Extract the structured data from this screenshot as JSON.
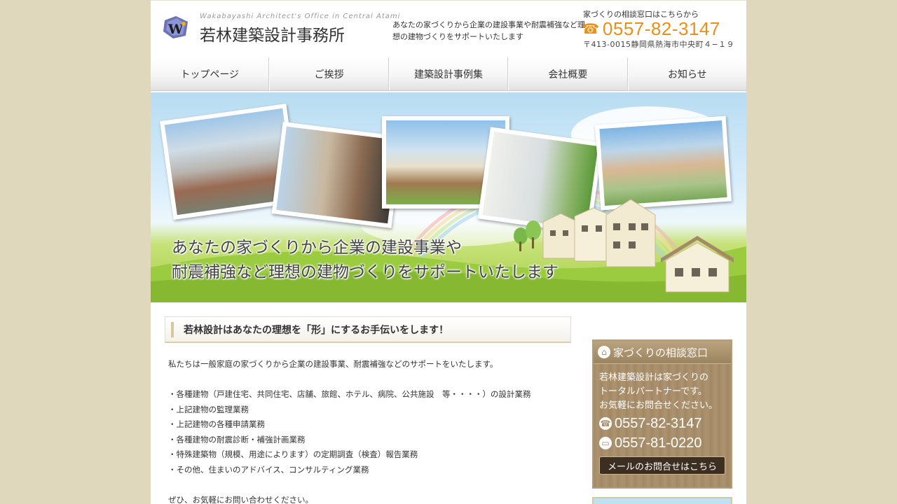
{
  "header": {
    "logo_mark": "W",
    "logo_en": "Wakabayashi Architect's Office in Central Atami",
    "logo_jp": "若林建築設計事務所",
    "tagline": "あなたの家づくりから企業の建設事業や耐震補強など理想の建物づくりをサポートいたします",
    "contact_label": "家づくりの相談窓口はこちらから",
    "phone": "0557-82-3147",
    "address": "〒413-0015静岡県熱海市中央町４−１９"
  },
  "nav": {
    "items": [
      {
        "label": "トップページ"
      },
      {
        "label": "ご挨拶"
      },
      {
        "label": "建築設計事例集"
      },
      {
        "label": "会社概要"
      },
      {
        "label": "お知らせ"
      }
    ]
  },
  "hero": {
    "caption_line1": "あなたの家づくりから企業の建設事業や",
    "caption_line2": "耐震補強など理想の建物づくりをサポートいたします"
  },
  "main": {
    "heading": "若林設計はあなたの理想を「形」にするお手伝いをします！",
    "intro": "私たちは一般家庭の家づくりから企業の建設事業、耐震補強などのサポートをいたします。",
    "services": [
      "・各種建物（戸建住宅、共同住宅、店舗、旅館、ホテル、病院、公共施設　等・・・・）の設計業務",
      "・上記建物の監理業務",
      "・上記建物の各種申請業務",
      "・各種建物の耐震診断・補強計画業務",
      "・特殊建築物（規模、用途によります）の定期調査（検査）報告業務",
      "・その他、住まいのアドバイス、コンサルティング業務"
    ],
    "closing": "ぜひ、お気軽にお問い合わせください。"
  },
  "sidebar": {
    "title": "家づくりの相談窓口",
    "text_line1": "若林建築設計は家づくりの",
    "text_line2": "トータルパートナーです。",
    "text_line3": "お気軽にお問合せください。",
    "phone": "0557-82-3147",
    "fax": "0557-81-0220",
    "mail_button": "メールのお問合せはこちら"
  },
  "colors": {
    "page_background": "#e0d8bc",
    "phone_accent": "#e8901a",
    "sidebar_wood": "#a88f6c"
  }
}
